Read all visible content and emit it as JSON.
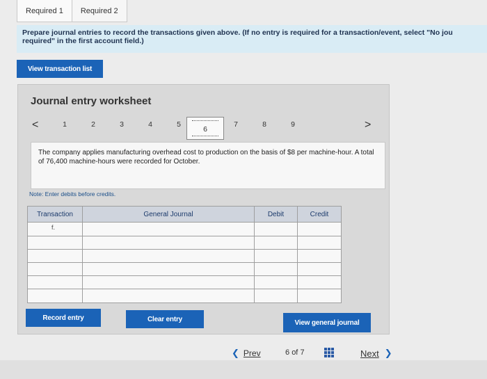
{
  "tabs": [
    {
      "label": "Required 1"
    },
    {
      "label": "Required 2"
    }
  ],
  "instruction": {
    "line1": "Prepare journal entries to record the transactions given above. (If no entry is required for a transaction/event, select \"No jou",
    "line2": "required\" in the first account field.)"
  },
  "view_transactions_label": "View transaction list",
  "worksheet": {
    "title": "Journal entry worksheet",
    "pages": [
      "1",
      "2",
      "3",
      "4",
      "5",
      "6",
      "7",
      "8",
      "9"
    ],
    "active_page": "6",
    "prev_arrow": "<",
    "next_arrow": ">",
    "description": "The company applies manufacturing overhead cost to production on the basis of $8 per machine-hour. A total of 76,400 machine-hours were recorded for October.",
    "note": "Note: Enter debits before credits.",
    "columns": {
      "transaction": "Transaction",
      "general_journal": "General Journal",
      "debit": "Debit",
      "credit": "Credit"
    },
    "first_transaction": "f."
  },
  "buttons": {
    "record": "Record entry",
    "clear": "Clear entry",
    "view_journal": "View general journal"
  },
  "footer_nav": {
    "prev": "Prev",
    "page_current": "6",
    "page_of": "of",
    "page_total": "7",
    "next": "Next"
  },
  "colors": {
    "accent": "#1b63b7",
    "instruction_bg": "#d9ecf5",
    "worksheet_bg": "#d9d9d9"
  }
}
